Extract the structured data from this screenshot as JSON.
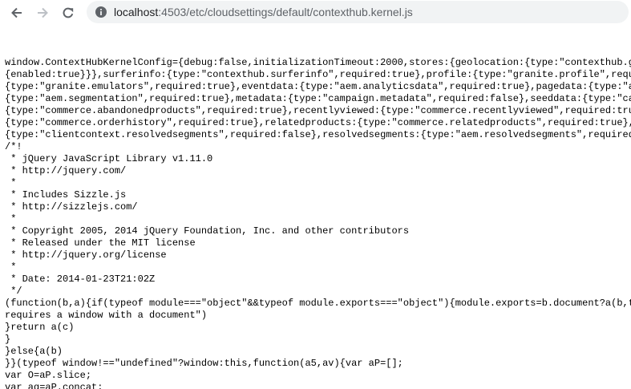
{
  "browser": {
    "url_host": "localhost",
    "url_port_path": ":4503/etc/cloudsettings/default/contexthub.kernel.js",
    "icons": {
      "back": "arrow-left-icon",
      "forward": "arrow-right-icon",
      "reload": "reload-icon",
      "site_info": "info-icon"
    }
  },
  "code_lines": [
    "window.ContextHubKernelConfig={debug:false,initializationTimeout:2000,stores:{geolocation:{type:\"contexthub.g",
    "{enabled:true}}},surferinfo:{type:\"contexthub.surferinfo\",required:true},profile:{type:\"granite.profile\",requ",
    "{type:\"granite.emulators\",required:true},eventdata:{type:\"aem.analyticsdata\",required:true},pagedata:{type:\"a",
    "{type:\"aem.segmentation\",required:true},metadata:{type:\"campaign.metadata\",required:false},seeddata:{type:\"ca",
    "{type:\"commerce.abandonedproducts\",required:true},recentlyviewed:{type:\"commerce.recentlyviewed\",required:tru",
    "{type:\"commerce.orderhistory\",required:true},relatedproducts:{type:\"commerce.relatedproducts\",required:true},",
    "{type:\"clientcontext.resolvedsegments\",required:false},resolvedsegments:{type:\"aem.resolvedsegments\",required",
    "/*!",
    " * jQuery JavaScript Library v1.11.0",
    " * http://jquery.com/",
    " *",
    " * Includes Sizzle.js",
    " * http://sizzlejs.com/",
    " *",
    " * Copyright 2005, 2014 jQuery Foundation, Inc. and other contributors",
    " * Released under the MIT license",
    " * http://jquery.org/license",
    " *",
    " * Date: 2014-01-23T21:02Z",
    " */",
    "(function(b,a){if(typeof module===\"object\"&&typeof module.exports===\"object\"){module.exports=b.document?a(b,t",
    "requires a window with a document\")",
    "}return a(c)",
    "}",
    "}else{a(b)",
    "}}(typeof window!==\"undefined\"?window:this,function(a5,av){var aP=[];",
    "var O=aP.slice;",
    "var aq=aP.concat;"
  ]
}
